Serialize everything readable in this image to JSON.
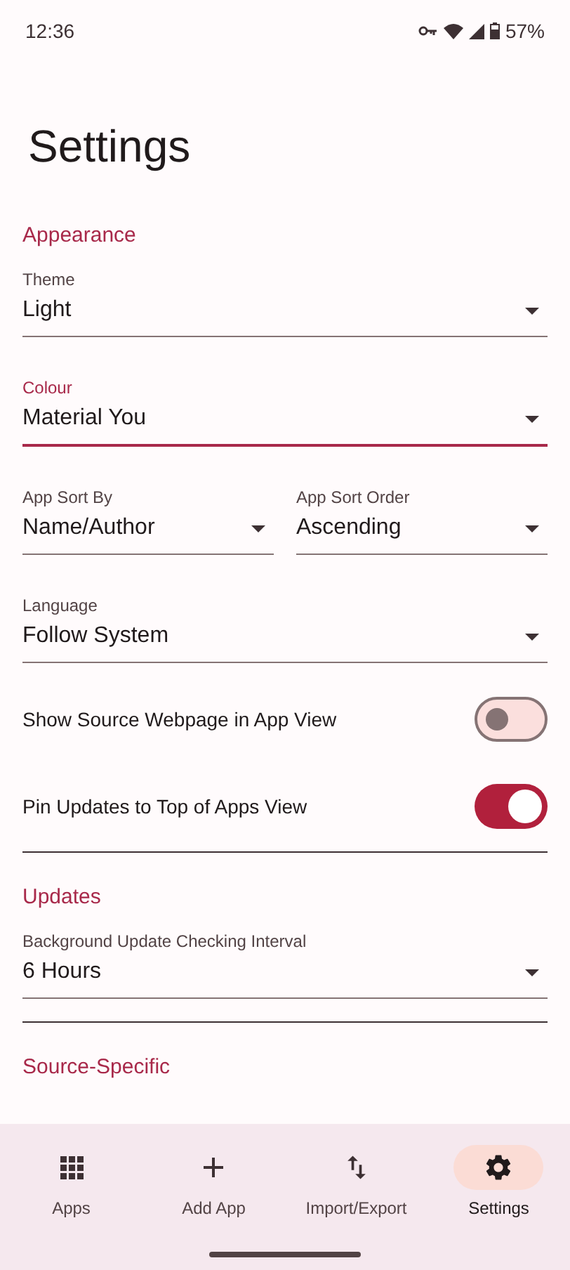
{
  "status_bar": {
    "time": "12:36",
    "battery": "57%"
  },
  "title": "Settings",
  "sections": [
    {
      "heading": "Appearance",
      "items": [
        {
          "kind": "dropdown",
          "label": "Theme",
          "value": "Light",
          "focused": false
        },
        {
          "kind": "dropdown",
          "label": "Colour",
          "value": "Material You",
          "focused": true
        },
        {
          "kind": "dropdown_pair",
          "fields": [
            {
              "label": "App Sort By",
              "value": "Name/Author",
              "focused": false
            },
            {
              "label": "App Sort Order",
              "value": "Ascending",
              "focused": false
            }
          ]
        },
        {
          "kind": "dropdown",
          "label": "Language",
          "value": "Follow System",
          "focused": false
        },
        {
          "kind": "switch",
          "label": "Show Source Webpage in App View",
          "on": false
        },
        {
          "kind": "switch",
          "label": "Pin Updates to Top of Apps View",
          "on": true
        }
      ]
    },
    {
      "heading": "Updates",
      "items": [
        {
          "kind": "dropdown",
          "label": "Background Update Checking Interval",
          "value": "6 Hours",
          "focused": false
        }
      ]
    },
    {
      "heading": "Source-Specific"
    }
  ],
  "nav": [
    {
      "label": "Apps",
      "kind": "grid",
      "selected": false
    },
    {
      "label": "Add App",
      "kind": "plus",
      "selected": false
    },
    {
      "label": "Import/Export",
      "kind": "arrows",
      "selected": false
    },
    {
      "label": "Settings",
      "kind": "gear",
      "selected": true
    }
  ]
}
